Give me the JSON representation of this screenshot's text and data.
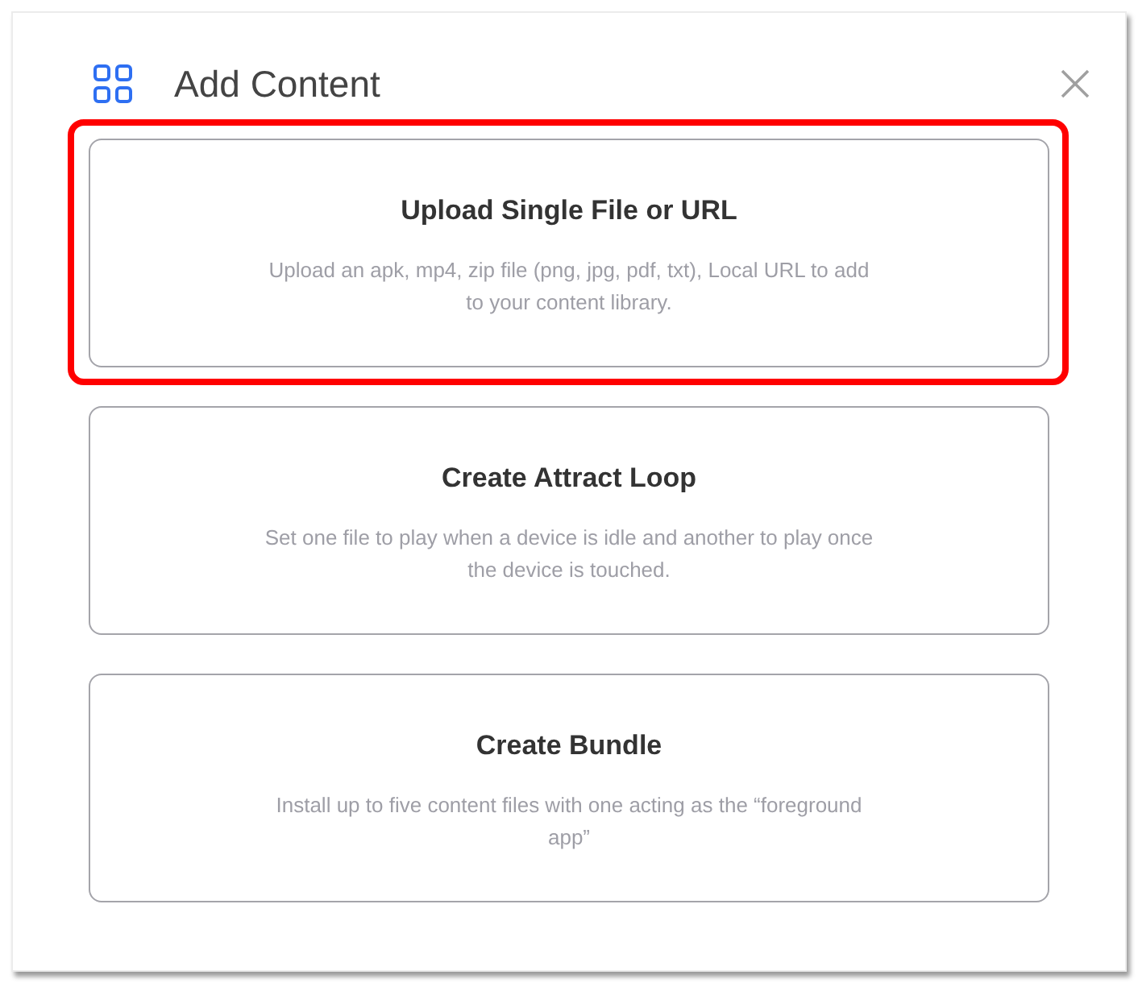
{
  "dialog": {
    "title": "Add Content"
  },
  "options": [
    {
      "title": "Upload Single File or URL",
      "description": "Upload an apk, mp4, zip file (png, jpg, pdf, txt), Local URL to add to your content library.",
      "highlighted": true
    },
    {
      "title": "Create Attract Loop",
      "description": "Set one file to play when a device is idle and another to play once the device is touched.",
      "highlighted": false
    },
    {
      "title": "Create Bundle",
      "description": "Install up to five content files with one acting as the “foreground app”",
      "highlighted": false
    }
  ]
}
